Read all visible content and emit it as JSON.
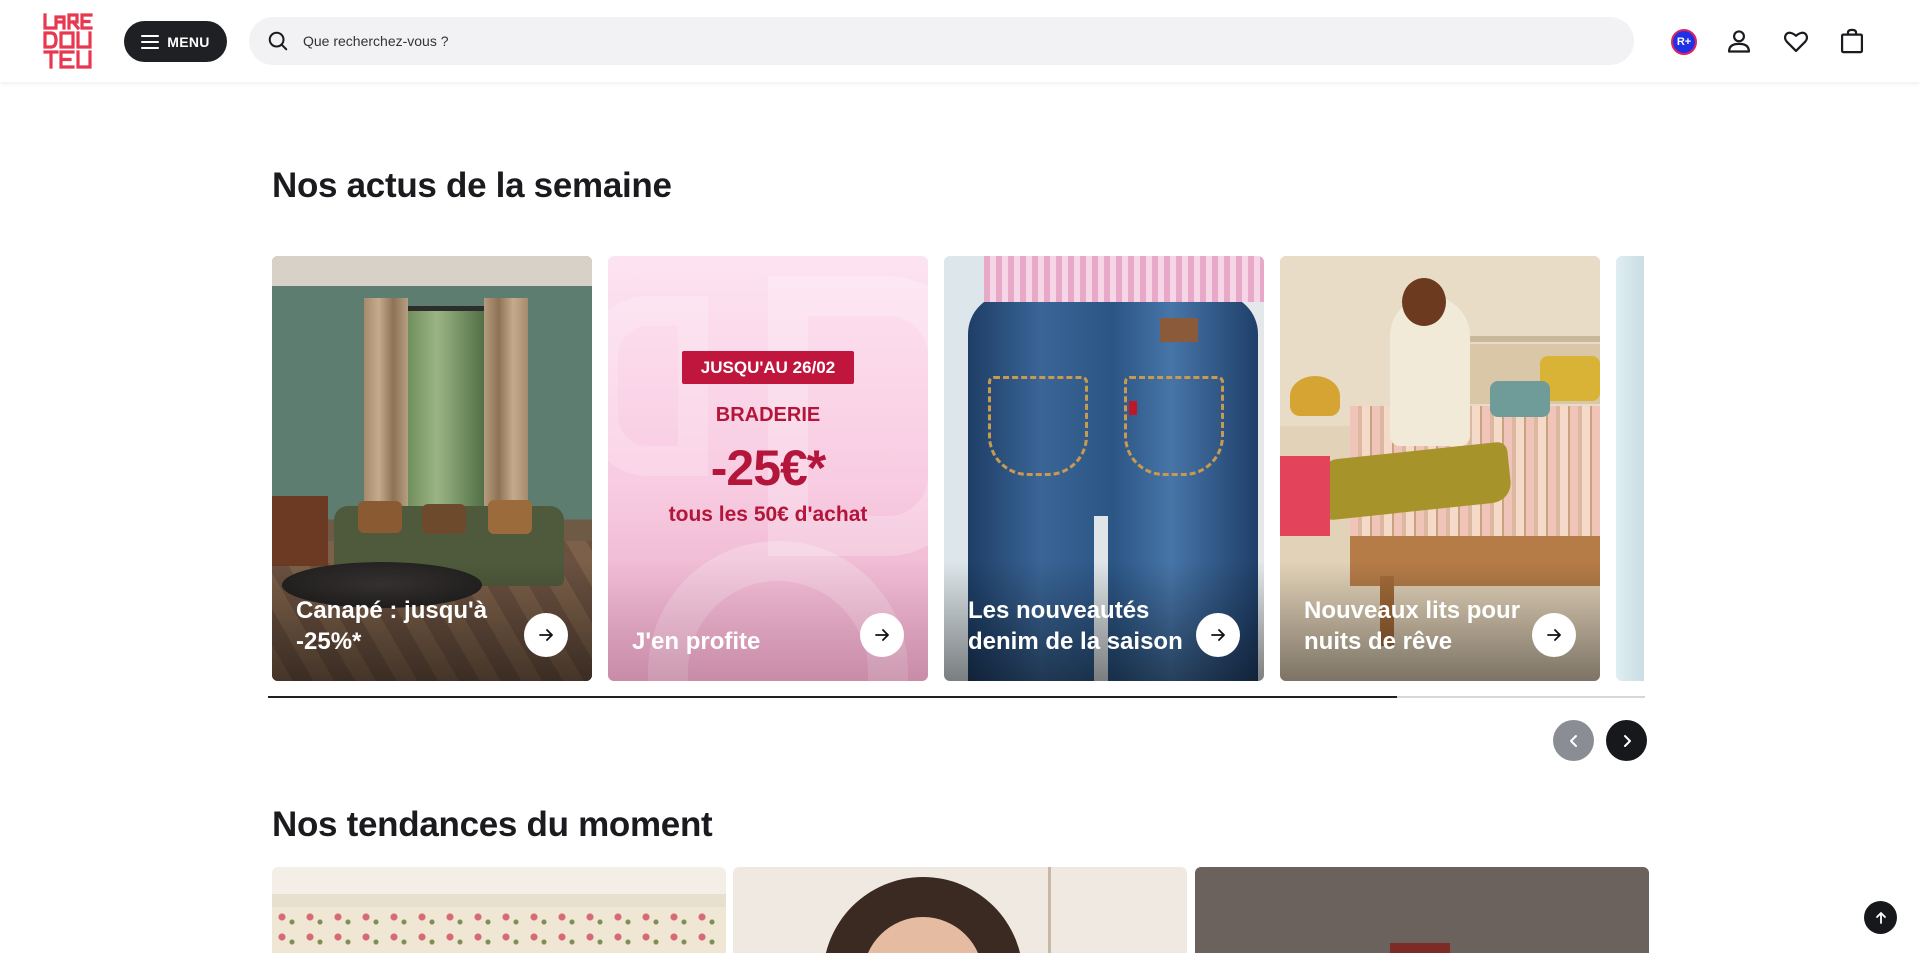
{
  "header": {
    "logo_text": "LA REDOUTE",
    "menu_label": "MENU",
    "search_placeholder": "Que recherchez-vous ?",
    "rplus_label": "R+",
    "icons": [
      "search-icon",
      "account-icon",
      "heart-icon",
      "bag-icon"
    ]
  },
  "section_news": {
    "title": "Nos actus de la semaine",
    "cards": [
      {
        "caption": "Canapé : jusqu'à -25%*"
      },
      {
        "badge": "JUSQU'AU 26/02",
        "event": "BRADERIE",
        "discount": "-25€*",
        "condition": "tous les 50€ d'achat",
        "caption": "J'en profite"
      },
      {
        "caption": "Les nouveautés denim de la saison"
      },
      {
        "caption": "Nouveaux lits pour nuits de rêve"
      }
    ],
    "progress": 0.82
  },
  "section_trends": {
    "title": "Nos tendances du moment"
  },
  "colors": {
    "accent_dark": "#1f2023",
    "promo_red": "#c0163d",
    "search_bg": "#f2f2f4",
    "rplus_blue": "#2130e6"
  }
}
